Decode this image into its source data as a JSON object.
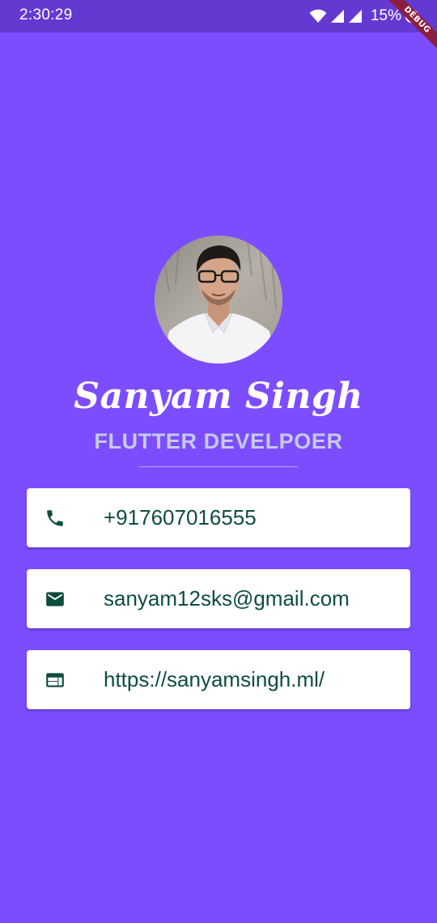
{
  "status_bar": {
    "time": "2:30:29",
    "battery_percent": "15%",
    "icons": [
      "wifi-icon",
      "signal-icon",
      "signal-icon",
      "battery-icon"
    ]
  },
  "debug_banner": {
    "label": "DEBUG",
    "color": "#8b1e3f"
  },
  "profile": {
    "name": "Sanyam Singh",
    "title": "FLUTTER DEVELPOER",
    "avatar": "profile-photo"
  },
  "contacts": [
    {
      "icon": "phone-icon",
      "value": "+917607016555"
    },
    {
      "icon": "email-icon",
      "value": "sanyam12sks@gmail.com"
    },
    {
      "icon": "web-icon",
      "value": "https://sanyamsingh.ml/"
    }
  ],
  "colors": {
    "background": "#7c4dff",
    "status_bar": "#6439d1",
    "title_text": "#c5cae9",
    "card_text": "#0d4d3f"
  }
}
